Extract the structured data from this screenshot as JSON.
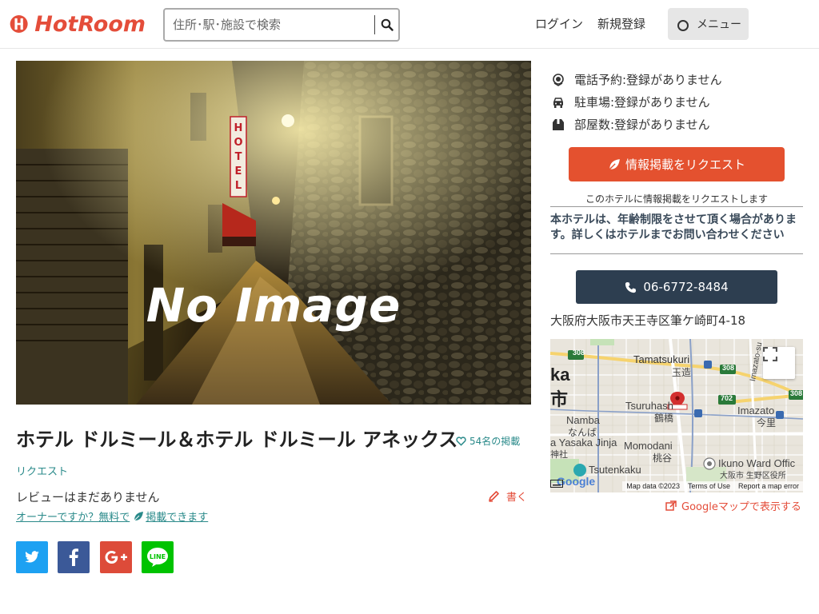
{
  "header": {
    "logo_text": "HotRoom",
    "search_placeholder": "住所･駅･施設で検索",
    "login": "ログイン",
    "signup": "新規登録",
    "menu": "メニュー"
  },
  "hero": {
    "overlay_text": "No Image"
  },
  "hotel": {
    "name": "ホテル ドルミール＆ホテル ドルミール アネックス",
    "favorites": "54名の掲載",
    "request_link": "リクエスト",
    "review_empty": "レビューはまだありません",
    "write_review": "書く",
    "owner_prefix": "オーナーですか？無料で",
    "owner_suffix": "掲載できます"
  },
  "info": {
    "phone_reservation": "電話予約:登録がありません",
    "parking": "駐車場:登録がありません",
    "rooms": "部屋数:登録がありません"
  },
  "request": {
    "button": "情報掲載をリクエスト",
    "note": "このホテルに情報掲載をリクエストします"
  },
  "notice": "本ホテルは、年齢制限をさせて頂く場合があります。詳しくはホテルまでお問い合わせください",
  "contact": {
    "phone": "06-6772-8484",
    "address": "大阪府大阪市天王寺区筆ケ崎町4-18"
  },
  "map": {
    "labels": {
      "tamatsukuri": "Tamatsukuri",
      "tamatsukuri_jp": "玉造",
      "ka": "ka",
      "shi": "市",
      "tsuruhashi": "Tsuruhash",
      "tsuruhashi_jp": "鶴橋",
      "imazato": "Imazato",
      "imazato_jp": "今里",
      "namba": "Namba",
      "namba_jp": "なんば",
      "yasaka": "a Yasaka Jinja",
      "jinja": "神社",
      "momodani": "Momodani",
      "momodani_jp": "桃谷",
      "tsutenkaku": "Tsutenkaku",
      "ikuno": "Ikuno Ward Offic",
      "ikuno_jp": "大阪市 生野区役所",
      "imazato_suji": "Imazato-su",
      "route_308a": "308",
      "route_308b": "308",
      "route_308c": "308",
      "route_702": "702",
      "google": "Google"
    },
    "footer_data": "Map data ©2023",
    "footer_terms": "Terms of Use",
    "footer_report": "Report a map error",
    "gmaps_link": "Googleマップで表示する"
  },
  "colors": {
    "brand": "#e44d3a",
    "teal": "#2a8a8a",
    "navy": "#2d3e50",
    "twitter": "#1da1f2",
    "facebook": "#3b5998",
    "googleplus": "#dd4b39",
    "line": "#00c300"
  },
  "icons": {
    "phone": "headset-icon",
    "parking": "car-icon",
    "rooms": "box-icon",
    "search": "search-icon"
  }
}
